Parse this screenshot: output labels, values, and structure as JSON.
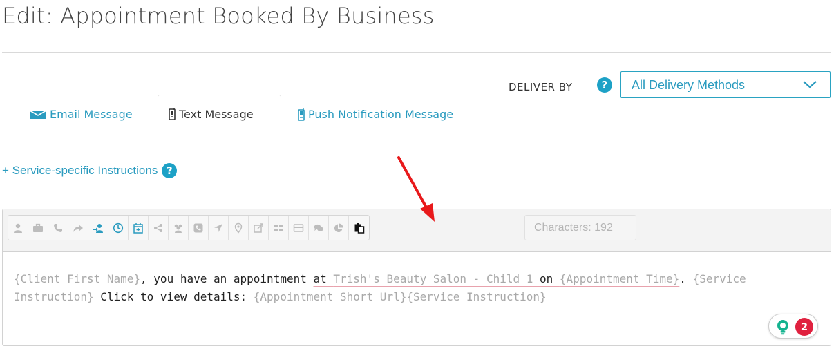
{
  "header": {
    "title": "Edit: Appointment Booked By Business"
  },
  "delivery": {
    "label": "DELIVER BY",
    "help_icon": "question-icon",
    "selected": "All Delivery Methods"
  },
  "tabs": [
    {
      "label": "Email Message",
      "icon": "envelope-icon",
      "active": false
    },
    {
      "label": "Text Message",
      "icon": "mobile-phone-icon",
      "active": true
    },
    {
      "label": "Push Notification Message",
      "icon": "mobile-phone-icon",
      "active": false
    }
  ],
  "service_link": {
    "label": "+ Service-specific Instructions"
  },
  "toolbar": {
    "buttons": [
      "user-icon",
      "briefcase-icon",
      "phone-icon",
      "share-arrow-icon",
      "user-arrow-icon",
      "clock-icon",
      "calendar-plus-icon",
      "share-nodes-icon",
      "group-icon",
      "phone-square-icon",
      "location-arrow-icon",
      "map-marker-icon",
      "external-link-icon",
      "grid-icon",
      "credit-card-icon",
      "comments-icon",
      "pie-chart-icon",
      "paste-icon"
    ],
    "characters": "Characters: 192"
  },
  "message": {
    "t1": "{Client First Name}",
    "t2": ", you have an appointment ",
    "t3": "at ",
    "t4": "Trish's Beauty Salon - Child 1",
    "t5": " on ",
    "t6": "{Appointment Time}",
    "t7": ".",
    "t8": " {Service Instruction}",
    "t9": "  Click to view details: ",
    "t10": "{Appointment Short Url}",
    "t11": "{Service Instruction}"
  },
  "grammar": {
    "count": "2"
  },
  "colors": {
    "accent": "#2a9bbf",
    "help": "#1da1c6",
    "badge": "#e0213f",
    "annotation_arrow": "#e8191b"
  }
}
